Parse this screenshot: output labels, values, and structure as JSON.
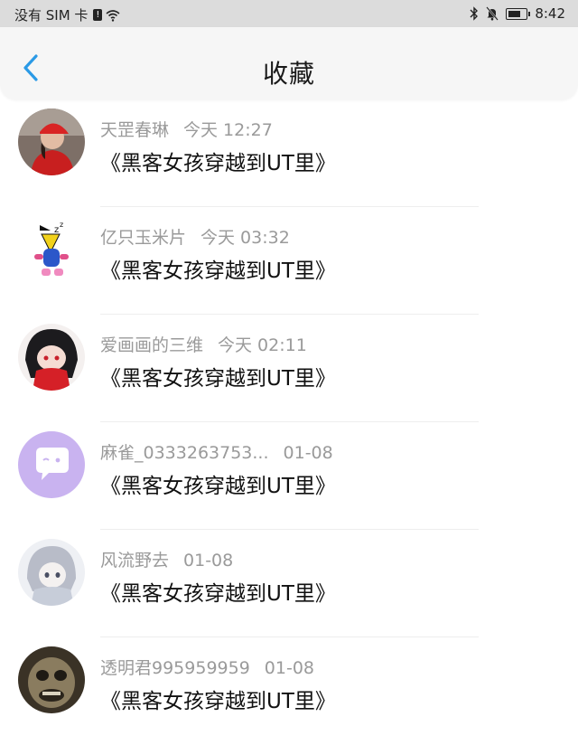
{
  "status_bar": {
    "carrier": "没有 SIM 卡",
    "time": "8:42"
  },
  "header": {
    "title": "收藏"
  },
  "items": [
    {
      "user": "天罡春琳",
      "time": "今天 12:27",
      "title": "《黑客女孩穿越到UT里》",
      "avatar": "avatar-red-cap"
    },
    {
      "user": "亿只玉米片",
      "time": "今天 03:32",
      "title": "《黑客女孩穿越到UT里》",
      "avatar": "avatar-cartoon-sleepy"
    },
    {
      "user": "爱画画的三维",
      "time": "今天 02:11",
      "title": "《黑客女孩穿越到UT里》",
      "avatar": "avatar-anime-red"
    },
    {
      "user": "麻雀_0333263753...",
      "time": "01-08",
      "title": "《黑客女孩穿越到UT里》",
      "avatar": "avatar-default-chat"
    },
    {
      "user": "风流野去",
      "time": "01-08",
      "title": "《黑客女孩穿越到UT里》",
      "avatar": "avatar-anime-gray"
    },
    {
      "user": "透明君995959959",
      "time": "01-08",
      "title": "《黑客女孩穿越到UT里》",
      "avatar": "avatar-dark-face"
    }
  ],
  "colors": {
    "accent": "#2b9ae6",
    "default_avatar_bg": "#c9b3f0"
  }
}
